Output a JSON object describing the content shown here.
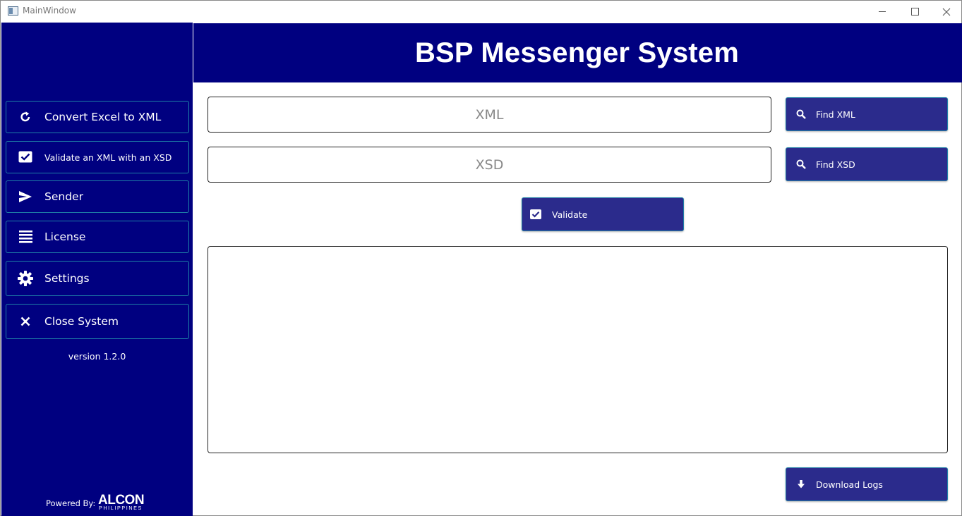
{
  "window": {
    "title": "MainWindow"
  },
  "sidebar": {
    "items": [
      {
        "label": "Convert Excel to XML",
        "icon": "refresh-icon"
      },
      {
        "label": "Validate an XML with an XSD",
        "icon": "checkbox-icon"
      },
      {
        "label": "Sender",
        "icon": "send-icon"
      },
      {
        "label": "License",
        "icon": "list-icon"
      },
      {
        "label": "Settings",
        "icon": "gear-icon"
      },
      {
        "label": "Close System",
        "icon": "close-icon"
      }
    ],
    "version": "version 1.2.0",
    "powered_by": "Powered By:",
    "logo_text": "ALCON",
    "logo_subtext": "PHILIPPINES"
  },
  "header": {
    "title": "BSP Messenger System"
  },
  "main": {
    "xml_field": {
      "placeholder": "XML",
      "value": ""
    },
    "xsd_field": {
      "placeholder": "XSD",
      "value": ""
    },
    "find_xml_label": "Find XML",
    "find_xsd_label": "Find XSD",
    "validate_label": "Validate",
    "download_logs_label": "Download Logs",
    "log_text": ""
  },
  "colors": {
    "primary": "#000080",
    "button": "#2b2b8c",
    "border_accent": "#1e7fa6"
  }
}
